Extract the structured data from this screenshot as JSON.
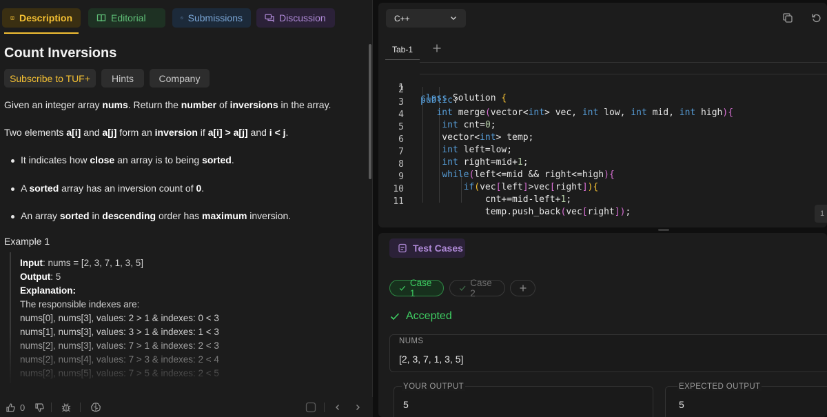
{
  "tabs": {
    "description": "Description",
    "editorial": "Editorial",
    "submissions": "Submissions",
    "discussion": "Discussion"
  },
  "problem": {
    "title": "Count Inversions",
    "chips": {
      "subscribe": "Subscribe to TUF+",
      "hints": "Hints",
      "company": "Company"
    },
    "p1": {
      "a": "Given an integer array ",
      "b": "nums",
      "c": ". Return the ",
      "d": "number",
      "e": " of ",
      "f": "inversions",
      "g": " in the array."
    },
    "p2": {
      "a": "Two elements ",
      "b": "a[i]",
      "c": " and ",
      "d": "a[j]",
      "e": " form an ",
      "f": "inversion",
      "g": " if ",
      "h": "a[i] > a[j]",
      "i": " and ",
      "j": "i < j",
      "k": "."
    },
    "b1": {
      "a": "It indicates how ",
      "b": "close",
      "c": " an array is to being ",
      "d": "sorted",
      "e": "."
    },
    "b2": {
      "a": "A ",
      "b": "sorted",
      "c": " array has an inversion count of ",
      "d": "0",
      "e": "."
    },
    "b3": {
      "a": "An array ",
      "b": "sorted",
      "c": " in ",
      "d": "descending",
      "e": " order has ",
      "f": "maximum",
      "g": " inversion."
    },
    "example_title": "Example 1",
    "example": {
      "input_label": "Input",
      "input_value": ": nums = [2, 3, 7, 1, 3, 5]",
      "output_label": "Output",
      "output_value": ": 5",
      "explanation_label": "Explanation",
      "explanation_colon": ":",
      "lines": [
        "The responsible indexes are:",
        "nums[0], nums[3], values: 2 > 1 & indexes: 0 < 3",
        "nums[1], nums[3], values: 3 > 1 & indexes: 1 < 3",
        "nums[2], nums[3], values: 7 > 1 & indexes: 2 < 3",
        "nums[2], nums[4], values: 7 > 3 & indexes: 2 < 4",
        "nums[2], nums[5], values: 7 > 5 & indexes: 2 < 5"
      ]
    }
  },
  "footer": {
    "likes": "0"
  },
  "editor": {
    "language": "C++",
    "file_tab": "Tab-1",
    "line_numbers": [
      "1",
      "2",
      "3",
      "4",
      "5",
      "6",
      "7",
      "8",
      "9",
      "10",
      "11"
    ],
    "bottom_btn": "1"
  },
  "tests": {
    "header": "Test Cases",
    "case1": "Case 1",
    "case2": "Case 2",
    "status": "Accepted",
    "nums_label": "NUMS",
    "nums_value": "[2, 3, 7, 1, 3, 5]",
    "your_output_label": "YOUR OUTPUT",
    "your_output_value": "5",
    "expected_output_label": "EXPECTED OUTPUT",
    "expected_output_value": "5"
  },
  "colors": {
    "accent_yellow": "#f4c033",
    "accent_green": "#3fcf63",
    "accent_purple": "#b08ad8",
    "keyword_blue": "#569cd6",
    "bracket_magenta": "#da70d6"
  }
}
